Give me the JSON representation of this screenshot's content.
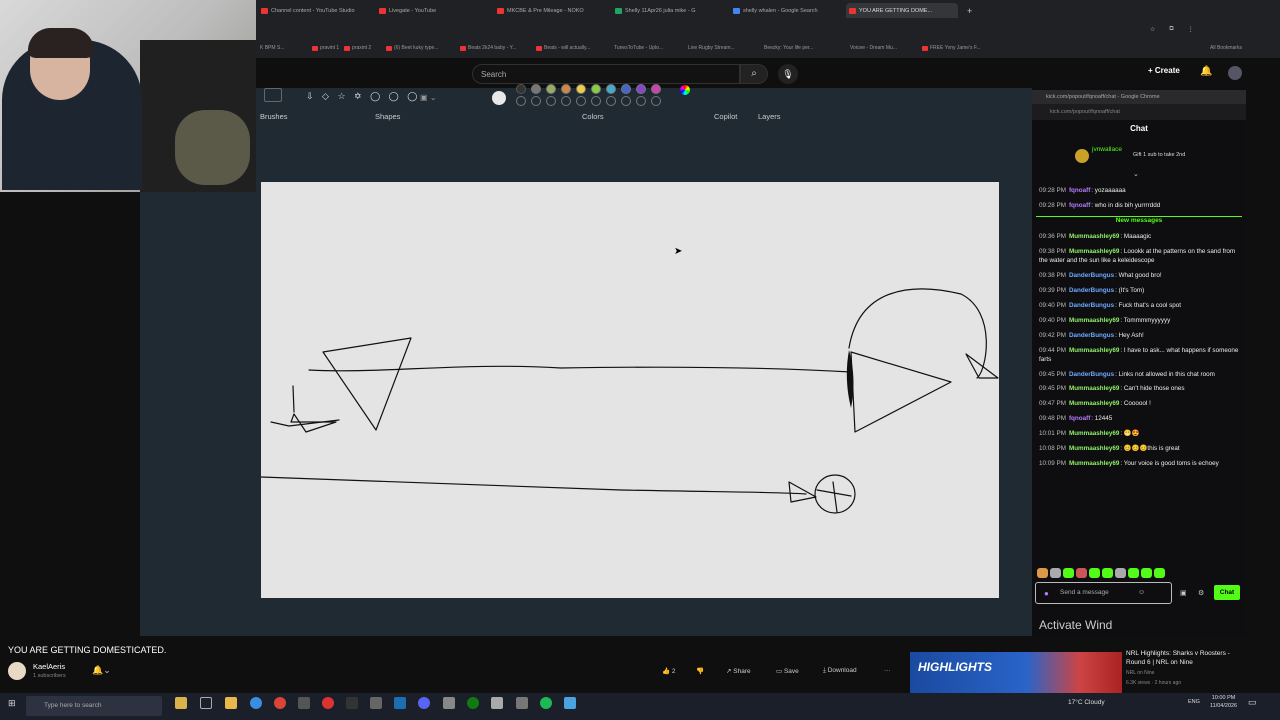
{
  "browser": {
    "tabs": [
      {
        "label": "Channel content - YouTube Studio",
        "active": false
      },
      {
        "label": "Livegate - YouTube",
        "active": false
      },
      {
        "label": "MKCBE & Pre Mileage - NOKO",
        "active": false
      },
      {
        "label": "Shelly 11Apr26 julia mike - G",
        "active": false
      },
      {
        "label": "shelly whalen - Google Search",
        "active": false
      },
      {
        "label": "YOU ARE GETTING DOME...",
        "active": true
      }
    ],
    "bookmarks": [
      "K BPM S...",
      "pravint 1",
      "praxint 2",
      "(6) Beet kuky type...",
      "Beats 2k24 baby - Y...",
      "Beats - will actually...",
      "TunesToTube - Uplo...",
      "Live Rugby Stream...",
      "Beezky: Your life per...",
      "Voicee - Dream Mu...",
      "FREE Yvny Jame's F..."
    ],
    "all_bookmarks": "All Bookmarks"
  },
  "youtube_header": {
    "search_placeholder": "Search",
    "create_label": "Create"
  },
  "paint": {
    "ribbon_labels": {
      "brushes": "Brushes",
      "shapes": "Shapes",
      "colors": "Colors",
      "copilot": "Copilot",
      "layers": "Layers"
    },
    "shape_glyphs": "⇩ ◇ ☆ ✡ ◯ ◯ ◯"
  },
  "chat": {
    "window_title": "kick.com/popout/fqnoaff/chat - Google Chrome",
    "url": "kick.com/popout/fqnoaff/chat",
    "header": "Chat",
    "pinned_user": "jvnwallace",
    "pinned_text": "Gift 1 sub to take 2nd",
    "new_messages_label": "New messages",
    "messages": [
      {
        "time": "09:28 PM",
        "user": "fqnoaff",
        "color": "#b57cff",
        "text": "yozaaaaaa"
      },
      {
        "time": "09:28 PM",
        "user": "fqnoaff",
        "color": "#b57cff",
        "text": "who in dis bih yurrrrddd"
      },
      {
        "time": "09:36 PM",
        "user": "Mummaashley69",
        "color": "#8ff06a",
        "text": "Maaaagic"
      },
      {
        "time": "09:38 PM",
        "user": "Mummaashley69",
        "color": "#8ff06a",
        "text": "Loookk at the patterns on the sand from the water and the sun like a keleidescope"
      },
      {
        "time": "09:38 PM",
        "user": "DanderBungus",
        "color": "#6fa8ff",
        "text": "What good bro!"
      },
      {
        "time": "09:39 PM",
        "user": "DanderBungus",
        "color": "#6fa8ff",
        "text": "(It's Tom)"
      },
      {
        "time": "09:40 PM",
        "user": "DanderBungus",
        "color": "#6fa8ff",
        "text": "Fuck that's a cool spot"
      },
      {
        "time": "09:40 PM",
        "user": "Mummaashley69",
        "color": "#8ff06a",
        "text": "Tommmmyyyyyy"
      },
      {
        "time": "09:42 PM",
        "user": "DanderBungus",
        "color": "#6fa8ff",
        "text": "Hey Ash!"
      },
      {
        "time": "09:44 PM",
        "user": "Mummaashley69",
        "color": "#8ff06a",
        "text": "I have to ask... what happens if someone farts"
      },
      {
        "time": "09:45 PM",
        "user": "DanderBungus",
        "color": "#6fa8ff",
        "text": "Links not allowed in this chat room"
      },
      {
        "time": "09:45 PM",
        "user": "Mummaashley69",
        "color": "#8ff06a",
        "text": "Can't hide those ones"
      },
      {
        "time": "09:47 PM",
        "user": "Mummaashley69",
        "color": "#8ff06a",
        "text": "Coooool !"
      },
      {
        "time": "09:48 PM",
        "user": "fqnoaff",
        "color": "#b57cff",
        "text": "12445"
      },
      {
        "time": "10:01 PM",
        "user": "Mummaashley69",
        "color": "#8ff06a",
        "text": "😁😍"
      },
      {
        "time": "10:08 PM",
        "user": "Mummaashley69",
        "color": "#8ff06a",
        "text": "😊😊😊this is great"
      },
      {
        "time": "10:09 PM",
        "user": "Mummaashley69",
        "color": "#8ff06a",
        "text": "Your voice is good toms is echoey"
      }
    ],
    "input_placeholder": "Send a message",
    "send_label": "Chat"
  },
  "activate_windows": "Activate Wind",
  "video": {
    "title": "YOU ARE GETTING DOMESTICATED.",
    "channel": "KaelAeris",
    "subscribers": "1 subscribers",
    "like_count": "2",
    "share": "Share",
    "save": "Save",
    "download": "Download",
    "more": "···"
  },
  "recommended": {
    "thumb_text": "HIGHLIGHTS",
    "title": "NRL Highlights: Sharks v Roosters - Round 6 | NRL on Nine",
    "channel": "NRL on Nine",
    "meta": "6.3K views · 2 hours ago"
  },
  "taskbar": {
    "search_placeholder": "Type here to search",
    "weather": "17°C  Cloudy",
    "lang": "ENG",
    "time": "10:00 PM",
    "date": "11/04/2026"
  }
}
